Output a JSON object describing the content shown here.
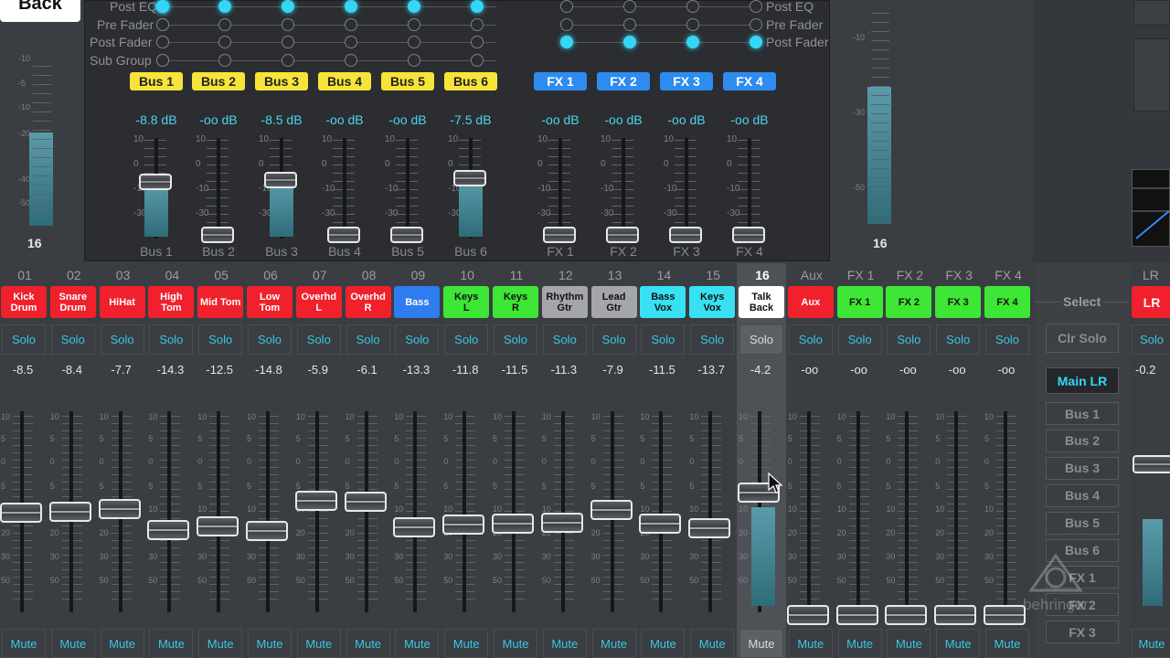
{
  "back_label": "Back",
  "left_meter": {
    "ticks": [
      "-10",
      "-5",
      "-10",
      "-20",
      "-40",
      "-50"
    ],
    "value_label": "16"
  },
  "right_meter": {
    "ticks": [
      "-10",
      "-30",
      "-50"
    ],
    "value_label": "16"
  },
  "tap_left": [
    "Post EQ",
    "Pre Fader",
    "Post Fader",
    "Sub Group"
  ],
  "tap_right": [
    "Post EQ",
    "Pre Fader",
    "Post Fader"
  ],
  "buses": [
    {
      "tag": "Bus 1",
      "db": "-8.8 dB",
      "name": "Bus 1",
      "level": 0.58
    },
    {
      "tag": "Bus 2",
      "db": "-oo dB",
      "name": "Bus 2",
      "level": 0
    },
    {
      "tag": "Bus 3",
      "db": "-8.5 dB",
      "name": "Bus 3",
      "level": 0.6
    },
    {
      "tag": "Bus 4",
      "db": "-oo dB",
      "name": "Bus 4",
      "level": 0
    },
    {
      "tag": "Bus 5",
      "db": "-oo dB",
      "name": "Bus 5",
      "level": 0
    },
    {
      "tag": "Bus 6",
      "db": "-7.5 dB",
      "name": "Bus 6",
      "level": 0.62
    }
  ],
  "fxsends": [
    {
      "tag": "FX 1",
      "db": "-oo dB",
      "name": "FX 1"
    },
    {
      "tag": "FX 2",
      "db": "-oo dB",
      "name": "FX 2"
    },
    {
      "tag": "FX 3",
      "db": "-oo dB",
      "name": "FX 3"
    },
    {
      "tag": "FX 4",
      "db": "-oo dB",
      "name": "FX 4"
    }
  ],
  "send_scale": [
    "10",
    "0",
    "-10",
    "-30"
  ],
  "channels": [
    {
      "num": "01",
      "name": "Kick\nDrum",
      "color": "#f0212c",
      "text": "#fff",
      "solo": "Solo",
      "level": "-8.5",
      "mute": "Mute"
    },
    {
      "num": "02",
      "name": "Snare\nDrum",
      "color": "#f0212c",
      "text": "#fff",
      "solo": "Solo",
      "level": "-8.4",
      "mute": "Mute"
    },
    {
      "num": "03",
      "name": "HiHat",
      "color": "#f0212c",
      "text": "#fff",
      "solo": "Solo",
      "level": "-7.7",
      "mute": "Mute"
    },
    {
      "num": "04",
      "name": "High\nTom",
      "color": "#f0212c",
      "text": "#fff",
      "solo": "Solo",
      "level": "-14.3",
      "mute": "Mute"
    },
    {
      "num": "05",
      "name": "Mid Tom",
      "color": "#f0212c",
      "text": "#fff",
      "solo": "Solo",
      "level": "-12.5",
      "mute": "Mute"
    },
    {
      "num": "06",
      "name": "Low\nTom",
      "color": "#f0212c",
      "text": "#fff",
      "solo": "Solo",
      "level": "-14.8",
      "mute": "Mute"
    },
    {
      "num": "07",
      "name": "Overhd\nL",
      "color": "#f0212c",
      "text": "#fff",
      "solo": "Solo",
      "level": "-5.9",
      "mute": "Mute"
    },
    {
      "num": "08",
      "name": "Overhd\nR",
      "color": "#f0212c",
      "text": "#fff",
      "solo": "Solo",
      "level": "-6.1",
      "mute": "Mute"
    },
    {
      "num": "09",
      "name": "Bass",
      "color": "#2e7cf0",
      "text": "#fff",
      "solo": "Solo",
      "level": "-13.3",
      "mute": "Mute"
    },
    {
      "num": "10",
      "name": "Keys\nL",
      "color": "#3ee635",
      "text": "#111",
      "solo": "Solo",
      "level": "-11.8",
      "mute": "Mute"
    },
    {
      "num": "11",
      "name": "Keys\nR",
      "color": "#3ee635",
      "text": "#111",
      "solo": "Solo",
      "level": "-11.5",
      "mute": "Mute"
    },
    {
      "num": "12",
      "name": "Rhythm\nGtr",
      "color": "#a4a6a9",
      "text": "#111",
      "solo": "Solo",
      "level": "-11.3",
      "mute": "Mute"
    },
    {
      "num": "13",
      "name": "Lead\nGtr",
      "color": "#a4a6a9",
      "text": "#111",
      "solo": "Solo",
      "level": "-7.9",
      "mute": "Mute"
    },
    {
      "num": "14",
      "name": "Bass\nVox",
      "color": "#38e0f3",
      "text": "#111",
      "solo": "Solo",
      "level": "-11.5",
      "mute": "Mute"
    },
    {
      "num": "15",
      "name": "Keys\nVox",
      "color": "#38e0f3",
      "text": "#111",
      "solo": "Solo",
      "level": "-13.7",
      "mute": "Mute"
    },
    {
      "num": "16",
      "name": "Talk\nBack",
      "color": "#ffffff",
      "text": "#111",
      "solo": "Solo",
      "level": "-4.2",
      "mute": "Mute"
    },
    {
      "num": "Aux",
      "name": "Aux",
      "color": "#f0212c",
      "text": "#fff",
      "solo": "Solo",
      "level": "-oo",
      "mute": "Mute"
    },
    {
      "num": "FX 1",
      "name": "FX 1",
      "color": "#3ee635",
      "text": "#111",
      "solo": "Solo",
      "level": "-oo",
      "mute": "Mute"
    },
    {
      "num": "FX 2",
      "name": "FX 2",
      "color": "#3ee635",
      "text": "#111",
      "solo": "Solo",
      "level": "-oo",
      "mute": "Mute"
    },
    {
      "num": "FX 3",
      "name": "FX 3",
      "color": "#3ee635",
      "text": "#111",
      "solo": "Solo",
      "level": "-oo",
      "mute": "Mute"
    },
    {
      "num": "FX 4",
      "name": "FX 4",
      "color": "#3ee635",
      "text": "#111",
      "solo": "Solo",
      "level": "-oo",
      "mute": "Mute"
    }
  ],
  "channel_scale": [
    "10",
    "5",
    "0",
    "5",
    "10",
    "20",
    "30",
    "50"
  ],
  "select": {
    "label": "Select",
    "clr_solo": "Clr Solo",
    "main_lr": "Main LR",
    "items": [
      "Bus 1",
      "Bus 2",
      "Bus 3",
      "Bus 4",
      "Bus 5",
      "Bus 6",
      "FX 1",
      "FX 2",
      "FX 3"
    ]
  },
  "lr": {
    "num": "LR",
    "name": "LR",
    "solo": "Solo",
    "level": "-0.2",
    "mute": "Mute"
  },
  "brand": "behringer",
  "colors": {
    "accent": "#35d6f5",
    "bus_tag": "#f7e43a",
    "fx_tag": "#2e8cf0",
    "red": "#f0212c",
    "green": "#3ee635"
  }
}
